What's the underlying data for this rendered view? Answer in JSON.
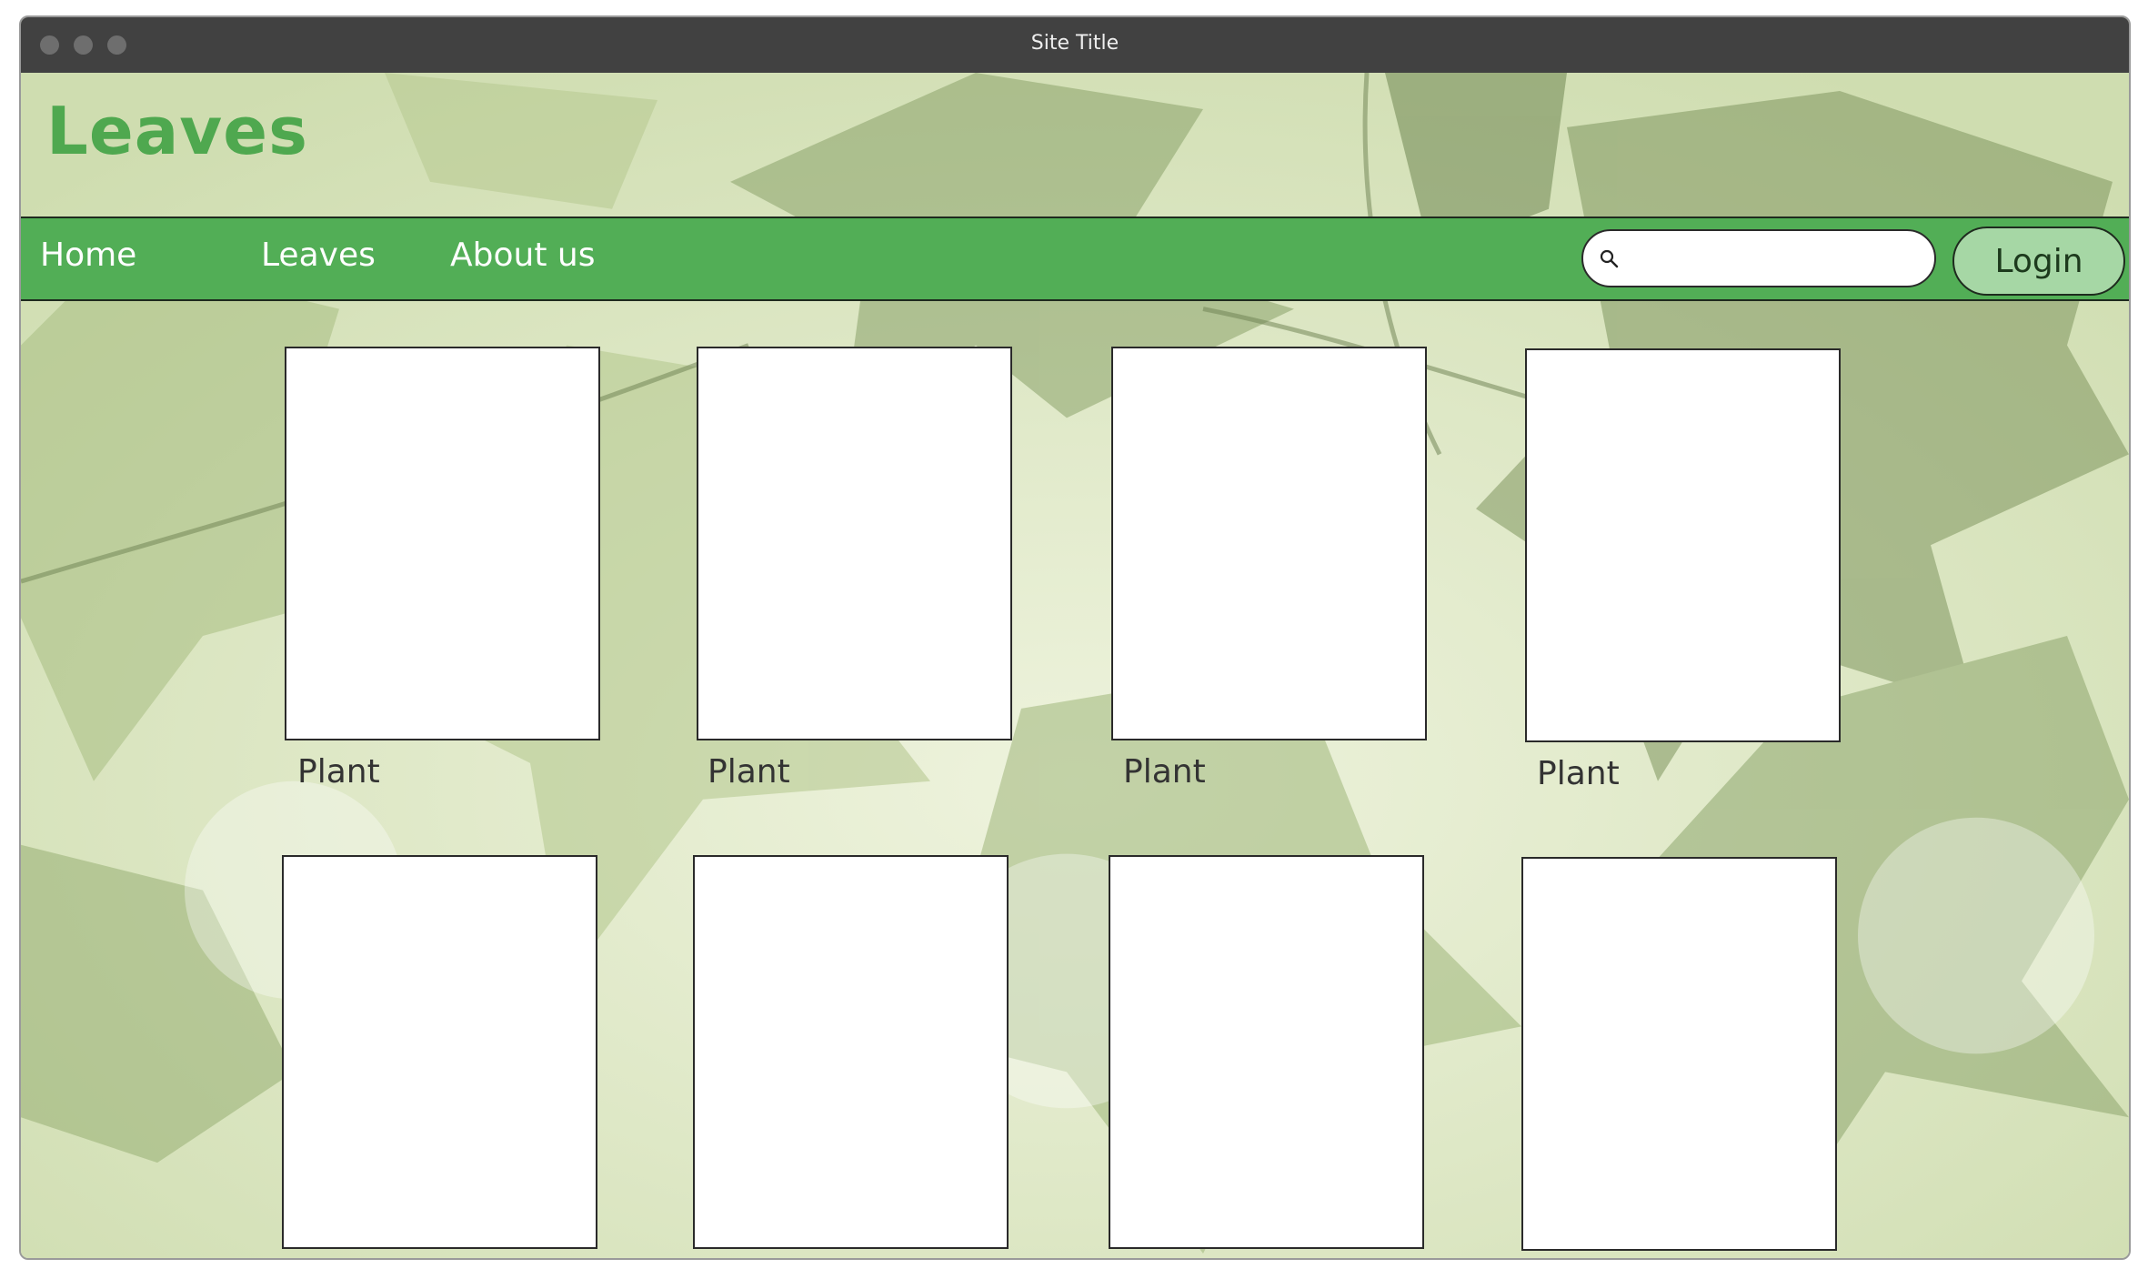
{
  "window": {
    "title": "Site Title"
  },
  "site": {
    "logo": "Leaves"
  },
  "nav": {
    "items": [
      {
        "label": "Home"
      },
      {
        "label": "Leaves"
      },
      {
        "label": "About us"
      }
    ],
    "search": {
      "value": "",
      "placeholder": ""
    },
    "login_label": "Login"
  },
  "grid": {
    "rows": [
      {
        "cards": [
          {
            "label": "Plant"
          },
          {
            "label": "Plant"
          },
          {
            "label": "Plant"
          },
          {
            "label": "Plant"
          }
        ]
      },
      {
        "cards": [
          {
            "label": ""
          },
          {
            "label": ""
          },
          {
            "label": ""
          },
          {
            "label": ""
          }
        ]
      }
    ]
  },
  "icons": {
    "search": "search-icon"
  },
  "colors": {
    "nav_green": "#52ae56",
    "logo_green": "#4fa84f",
    "login_green": "#a6d7a5",
    "titlebar": "#414141"
  }
}
